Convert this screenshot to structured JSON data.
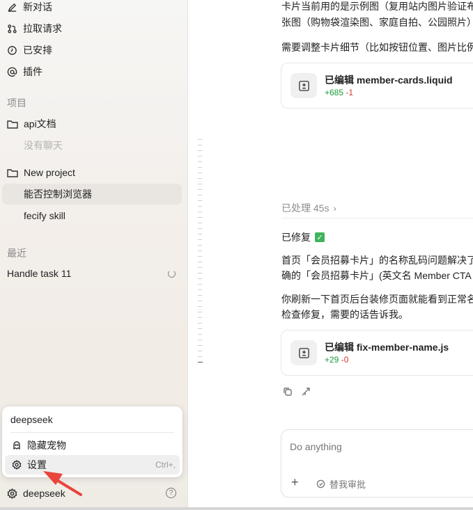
{
  "sidebar": {
    "nav": [
      {
        "label": "新对话",
        "icon": "edit-icon"
      },
      {
        "label": "拉取请求",
        "icon": "pull-request-icon"
      },
      {
        "label": "已安排",
        "icon": "clock-icon"
      },
      {
        "label": "插件",
        "icon": "at-icon"
      }
    ],
    "projects_title": "项目",
    "projects": [
      {
        "name": "api文档",
        "chats": [
          "没有聊天"
        ]
      },
      {
        "name": "New project",
        "chats": [
          "能否控制浏览器",
          "fecify skill"
        ]
      }
    ],
    "recent_title": "最近",
    "recent": [
      {
        "label": "Handle task 11"
      }
    ],
    "popup": {
      "title": "deepseek",
      "items": [
        {
          "label": "隐藏宠物",
          "icon": "pet-icon"
        },
        {
          "label": "设置",
          "icon": "gear-icon",
          "shortcut": "Ctrl+,"
        }
      ]
    },
    "user": {
      "name": "deepseek"
    }
  },
  "main": {
    "top_lines": [
      "卡片当前用的是示例图（复用站内图片验证布",
      "张图（购物袋渲染图、家庭自拍、公园照片）"
    ],
    "adjust_line": "需要调整卡片细节（比如按钮位置、图片比例",
    "card1": {
      "prefix": "已编辑",
      "file": "member-cards.liquid",
      "added": "+685",
      "removed": "-1"
    },
    "processed": "已处理 45s",
    "fixed": "已修复",
    "body_lines": [
      "首页「会员招募卡片」的名称乱码问题解决了",
      "确的「会员招募卡片」(英文名 Member CTA"
    ],
    "refresh_lines": [
      "你刷新一下首页后台装修页面就能看到正常名",
      "检查修复，需要的话告诉我。"
    ],
    "card2": {
      "prefix": "已编辑",
      "file": "fix-member-name.js",
      "added": "+29",
      "removed": "-0"
    },
    "composer": {
      "placeholder": "Do anything",
      "approve_label": "替我审批"
    }
  },
  "colors": {
    "added": "#1a9a3c",
    "removed": "#d4362c",
    "accent_arrow": "#e8453c"
  }
}
